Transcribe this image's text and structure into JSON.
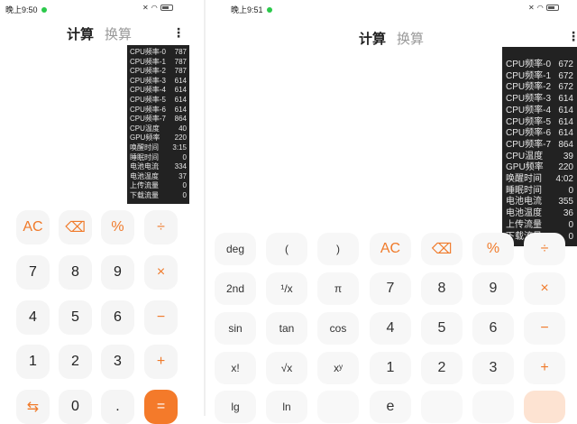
{
  "left_screen": {
    "status": {
      "time": "晚上9:50"
    },
    "tabs": {
      "active": "计算",
      "inactive": "换算"
    },
    "overlay": [
      {
        "label": "CPU频率-0",
        "value": "787"
      },
      {
        "label": "CPU频率-1",
        "value": "787"
      },
      {
        "label": "CPU频率-2",
        "value": "787"
      },
      {
        "label": "CPU频率-3",
        "value": "614"
      },
      {
        "label": "CPU频率-4",
        "value": "614"
      },
      {
        "label": "CPU频率-5",
        "value": "614"
      },
      {
        "label": "CPU频率-6",
        "value": "614"
      },
      {
        "label": "CPU频率-7",
        "value": "864"
      },
      {
        "label": "CPU温度",
        "value": "40"
      },
      {
        "label": "GPU频率",
        "value": "220"
      },
      {
        "label": "唤醒时间",
        "value": "3:15"
      },
      {
        "label": "睡眠时间",
        "value": "0"
      },
      {
        "label": "电池电流",
        "value": "334"
      },
      {
        "label": "电池温度",
        "value": "37"
      },
      {
        "label": "上传流量",
        "value": "0"
      },
      {
        "label": "下载流量",
        "value": "0"
      }
    ],
    "keys": [
      {
        "label": "AC",
        "style": "orange"
      },
      {
        "label": "⌫",
        "style": "orange"
      },
      {
        "label": "%",
        "style": "orange"
      },
      {
        "label": "÷",
        "style": "orange"
      },
      {
        "label": "7",
        "style": ""
      },
      {
        "label": "8",
        "style": ""
      },
      {
        "label": "9",
        "style": ""
      },
      {
        "label": "×",
        "style": "orange"
      },
      {
        "label": "4",
        "style": ""
      },
      {
        "label": "5",
        "style": ""
      },
      {
        "label": "6",
        "style": ""
      },
      {
        "label": "−",
        "style": "orange"
      },
      {
        "label": "1",
        "style": ""
      },
      {
        "label": "2",
        "style": ""
      },
      {
        "label": "3",
        "style": ""
      },
      {
        "label": "+",
        "style": "orange"
      },
      {
        "label": "⇆",
        "style": "orange"
      },
      {
        "label": "0",
        "style": ""
      },
      {
        "label": ".",
        "style": ""
      },
      {
        "label": "=",
        "style": "eq"
      }
    ]
  },
  "right_screen": {
    "status": {
      "time": "晚上9:51"
    },
    "tabs": {
      "active": "计算",
      "inactive": "换算"
    },
    "overlay": [
      {
        "label": "CPU频率-0",
        "value": "672"
      },
      {
        "label": "CPU频率-1",
        "value": "672"
      },
      {
        "label": "CPU频率-2",
        "value": "672"
      },
      {
        "label": "CPU频率-3",
        "value": "614"
      },
      {
        "label": "CPU频率-4",
        "value": "614"
      },
      {
        "label": "CPU频率-5",
        "value": "614"
      },
      {
        "label": "CPU频率-6",
        "value": "614"
      },
      {
        "label": "CPU频率-7",
        "value": "864"
      },
      {
        "label": "CPU温度",
        "value": "39"
      },
      {
        "label": "GPU频率",
        "value": "220"
      },
      {
        "label": "唤醒时间",
        "value": "4:02"
      },
      {
        "label": "睡眠时间",
        "value": "0"
      },
      {
        "label": "电池电流",
        "value": "355"
      },
      {
        "label": "电池温度",
        "value": "36"
      },
      {
        "label": "上传流量",
        "value": "0"
      },
      {
        "label": "下载流量",
        "value": "0"
      }
    ],
    "keys": [
      {
        "label": "deg",
        "style": ""
      },
      {
        "label": "(",
        "style": ""
      },
      {
        "label": ")",
        "style": ""
      },
      {
        "label": "AC",
        "style": "orange"
      },
      {
        "label": "⌫",
        "style": "orange"
      },
      {
        "label": "%",
        "style": "orange"
      },
      {
        "label": "÷",
        "style": "orange"
      },
      {
        "label": "2nd",
        "style": ""
      },
      {
        "label": "¹/x",
        "style": ""
      },
      {
        "label": "π",
        "style": ""
      },
      {
        "label": "7",
        "style": "big"
      },
      {
        "label": "8",
        "style": "big"
      },
      {
        "label": "9",
        "style": "big"
      },
      {
        "label": "×",
        "style": "orange"
      },
      {
        "label": "sin",
        "style": ""
      },
      {
        "label": "tan",
        "style": ""
      },
      {
        "label": "cos",
        "style": ""
      },
      {
        "label": "4",
        "style": "big"
      },
      {
        "label": "5",
        "style": "big"
      },
      {
        "label": "6",
        "style": "big"
      },
      {
        "label": "−",
        "style": "orange"
      },
      {
        "label": "x!",
        "style": ""
      },
      {
        "label": "√x",
        "style": ""
      },
      {
        "label": "xʸ",
        "style": ""
      },
      {
        "label": "1",
        "style": "big"
      },
      {
        "label": "2",
        "style": "big"
      },
      {
        "label": "3",
        "style": "big"
      },
      {
        "label": "+",
        "style": "orange"
      },
      {
        "label": "lg",
        "style": ""
      },
      {
        "label": "ln",
        "style": ""
      },
      {
        "label": "",
        "style": "empty"
      },
      {
        "label": "e",
        "style": "big"
      },
      {
        "label": "",
        "style": "empty"
      },
      {
        "label": "",
        "style": "empty"
      },
      {
        "label": "",
        "style": "eqfade"
      }
    ]
  }
}
